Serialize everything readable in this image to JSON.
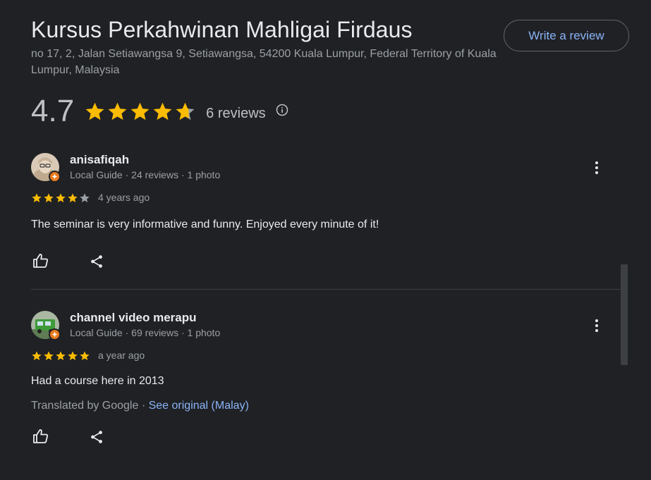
{
  "place": {
    "title": "Kursus Perkahwinan Mahligai Firdaus",
    "address": "no 17, 2, Jalan Setiawangsa 9, Setiawangsa, 54200 Kuala Lumpur, Federal Territory of Kuala Lumpur, Malaysia"
  },
  "write_review_label": "Write a review",
  "summary": {
    "rating": "4.7",
    "rating_value": 4.7,
    "review_count": "6 reviews",
    "info_icon": "info-icon"
  },
  "reviews": [
    {
      "name": "anisafiqah",
      "meta": "Local Guide · 24 reviews · 1 photo",
      "stars": 4,
      "date": "4 years ago",
      "text": "The seminar is very informative and funny. Enjoyed every minute of it!"
    },
    {
      "name": "channel video merapu",
      "meta": "Local Guide · 69 reviews · 1 photo",
      "stars": 5,
      "date": "a year ago",
      "text": "Had a course here in 2013",
      "translated_prefix": "Translated by Google · ",
      "see_original": "See original (Malay)"
    }
  ],
  "icons": {
    "like": "thumb-up-icon",
    "share": "share-icon",
    "more": "more-vert-icon",
    "star": "star-icon"
  },
  "colors": {
    "background": "#202124",
    "star": "#fbbc04",
    "star_empty": "#9aa0a6",
    "link": "#8ab4f8",
    "badge": "#ea7a1f"
  }
}
